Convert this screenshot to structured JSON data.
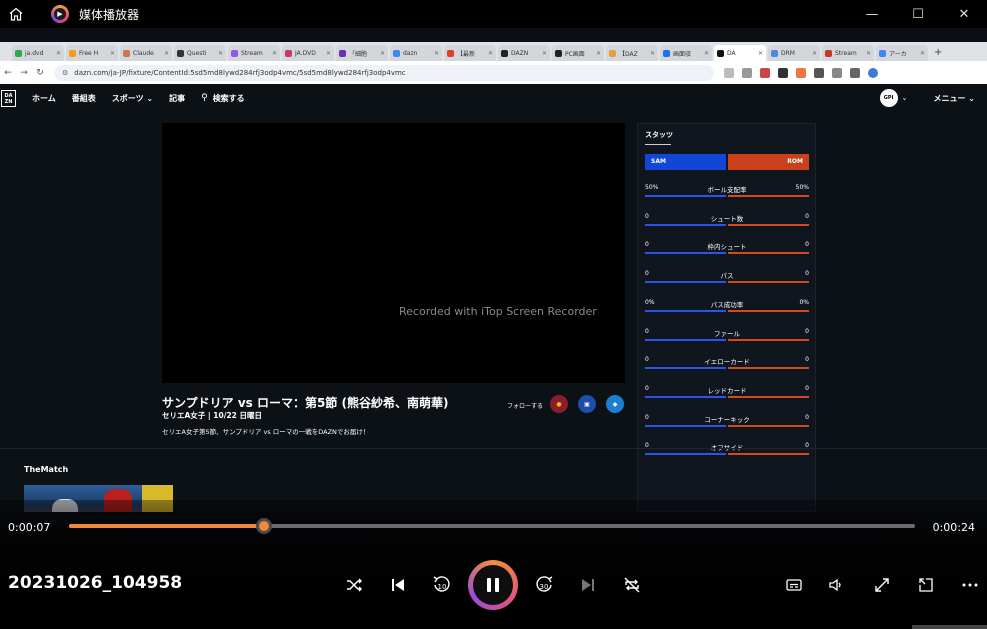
{
  "window": {
    "title": "媒体播放器",
    "controls": [
      "—",
      "☐",
      "✕"
    ]
  },
  "browser": {
    "tabs": [
      {
        "label": "ja.dvd",
        "color": "#2fa84f"
      },
      {
        "label": "Free H",
        "color": "#f59c1a"
      },
      {
        "label": "Claude",
        "color": "#c9774e"
      },
      {
        "label": "Questi",
        "color": "#333333"
      },
      {
        "label": "Stream",
        "color": "#8e58e8"
      },
      {
        "label": "JA.DVD",
        "color": "#c93a6a"
      },
      {
        "label": "「細胞",
        "color": "#6b2fb5"
      },
      {
        "label": "dazn",
        "color": "#4285f4"
      },
      {
        "label": "【最新",
        "color": "#d9412c"
      },
      {
        "label": "DAZN",
        "color": "#222222"
      },
      {
        "label": "PC画面",
        "color": "#222222"
      },
      {
        "label": "【DAZ",
        "color": "#e4a03a"
      },
      {
        "label": "画面収",
        "color": "#1a73e8"
      },
      {
        "label": "DA",
        "color": "#111111"
      },
      {
        "label": "DRM",
        "color": "#4a89dc"
      },
      {
        "label": "Stream",
        "color": "#c0392b"
      },
      {
        "label": "アーカ",
        "color": "#4285f4"
      }
    ],
    "active_tab_index": 13,
    "url": "dazn.com/ja-JP/fixture/ContentId:5sd5md8lywd284rfj3odp4vmc/5sd5md8lywd284rfj3odp4vmc"
  },
  "dazn": {
    "logo": "DA ZN",
    "nav": {
      "home": "ホーム",
      "schedule": "番組表",
      "sports": "スポーツ ⌄",
      "articles": "記事",
      "search": "検索する",
      "avatar": "GPI",
      "menu": "メニュー ⌄"
    },
    "player_watermark": "Recorded with iTop Screen Recorder",
    "match": {
      "title": "サンプドリア vs ローマ：第5節 (熊谷紗希、南萌華)",
      "subtitle": "セリエA女子 | 10/22 日曜日",
      "description": "セリエA女子第5節、サンプドリア vs ローマの一戦をDAZNでお届け！",
      "follow": "フォローする"
    },
    "stats": {
      "header": "スタッツ",
      "home_team": "SAM",
      "away_team": "ROM",
      "rows": [
        {
          "name": "ボール支配率",
          "home": "50%",
          "away": "50%"
        },
        {
          "name": "シュート数",
          "home": "0",
          "away": "0"
        },
        {
          "name": "枠内シュート",
          "home": "0",
          "away": "0"
        },
        {
          "name": "パス",
          "home": "0",
          "away": "0"
        },
        {
          "name": "パス成功率",
          "home": "0%",
          "away": "0%"
        },
        {
          "name": "ファール",
          "home": "0",
          "away": "0"
        },
        {
          "name": "イエローカード",
          "home": "0",
          "away": "0"
        },
        {
          "name": "レッドカード",
          "home": "0",
          "away": "0"
        },
        {
          "name": "コーナーキック",
          "home": "0",
          "away": "0"
        },
        {
          "name": "オフサイド",
          "home": "0",
          "away": "0"
        }
      ]
    },
    "section_title": "TheMatch"
  },
  "player": {
    "current_time": "0:00:07",
    "total_time": "0:00:24",
    "progress_fraction": 0.231,
    "filename": "20231026_104958",
    "accent": "#f0873a"
  }
}
